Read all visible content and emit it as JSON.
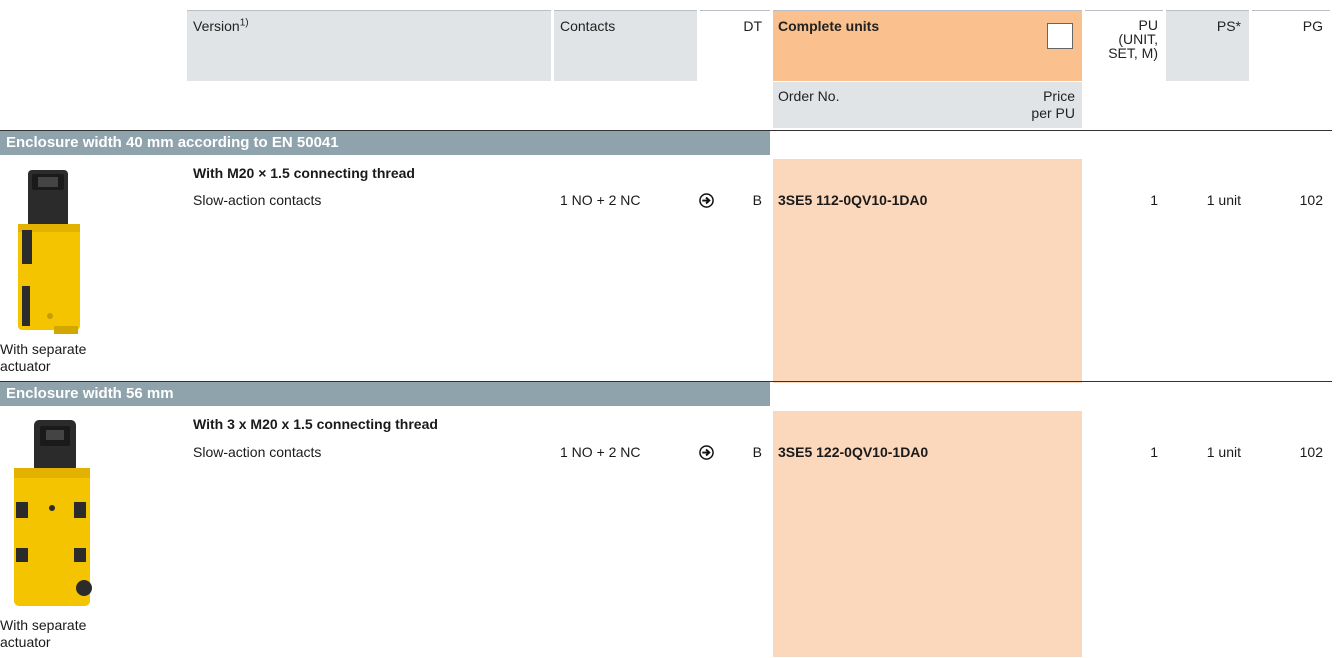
{
  "header": {
    "version_label": "Version",
    "version_sup": "1)",
    "contacts_label": "Contacts",
    "dt_label": "DT",
    "complete_units_label": "Complete units",
    "order_no_label": "Order No.",
    "price_label": "Price per PU",
    "pu_label": "PU (UNIT, SET, M)",
    "ps_label": "PS*",
    "pg_label": "PG"
  },
  "sections": [
    {
      "title": "Enclosure width 40 mm according to EN 50041",
      "image_caption": "With separate actuator",
      "subtitle": "With M20 × 1.5 connecting thread",
      "row": {
        "version": "Slow-action contacts",
        "contacts": "1 NO + 2 NC",
        "dt": "B",
        "order_no": "3SE5 112-0QV10-1DA0",
        "pu": "1",
        "ps": "1 unit",
        "pg": "102"
      }
    },
    {
      "title": "Enclosure width 56 mm",
      "image_caption": "With separate actuator",
      "subtitle": "With 3 x M20 x 1.5 connecting thread",
      "row": {
        "version": "Slow-action contacts",
        "contacts": "1 NO + 2 NC",
        "dt": "B",
        "order_no": "3SE5 122-0QV10-1DA0",
        "pu": "1",
        "ps": "1 unit",
        "pg": "102"
      }
    }
  ],
  "colors": {
    "header_grey": "#e1e4e6",
    "complete_units_orange": "#fac08e",
    "order_area_peach": "#fbd7bb",
    "section_band": "#8fa3ad",
    "product_yellow": "#f5c400"
  },
  "icons": [
    "arrow-right-circle-icon",
    "checkbox-icon",
    "safety-switch-product-image"
  ]
}
